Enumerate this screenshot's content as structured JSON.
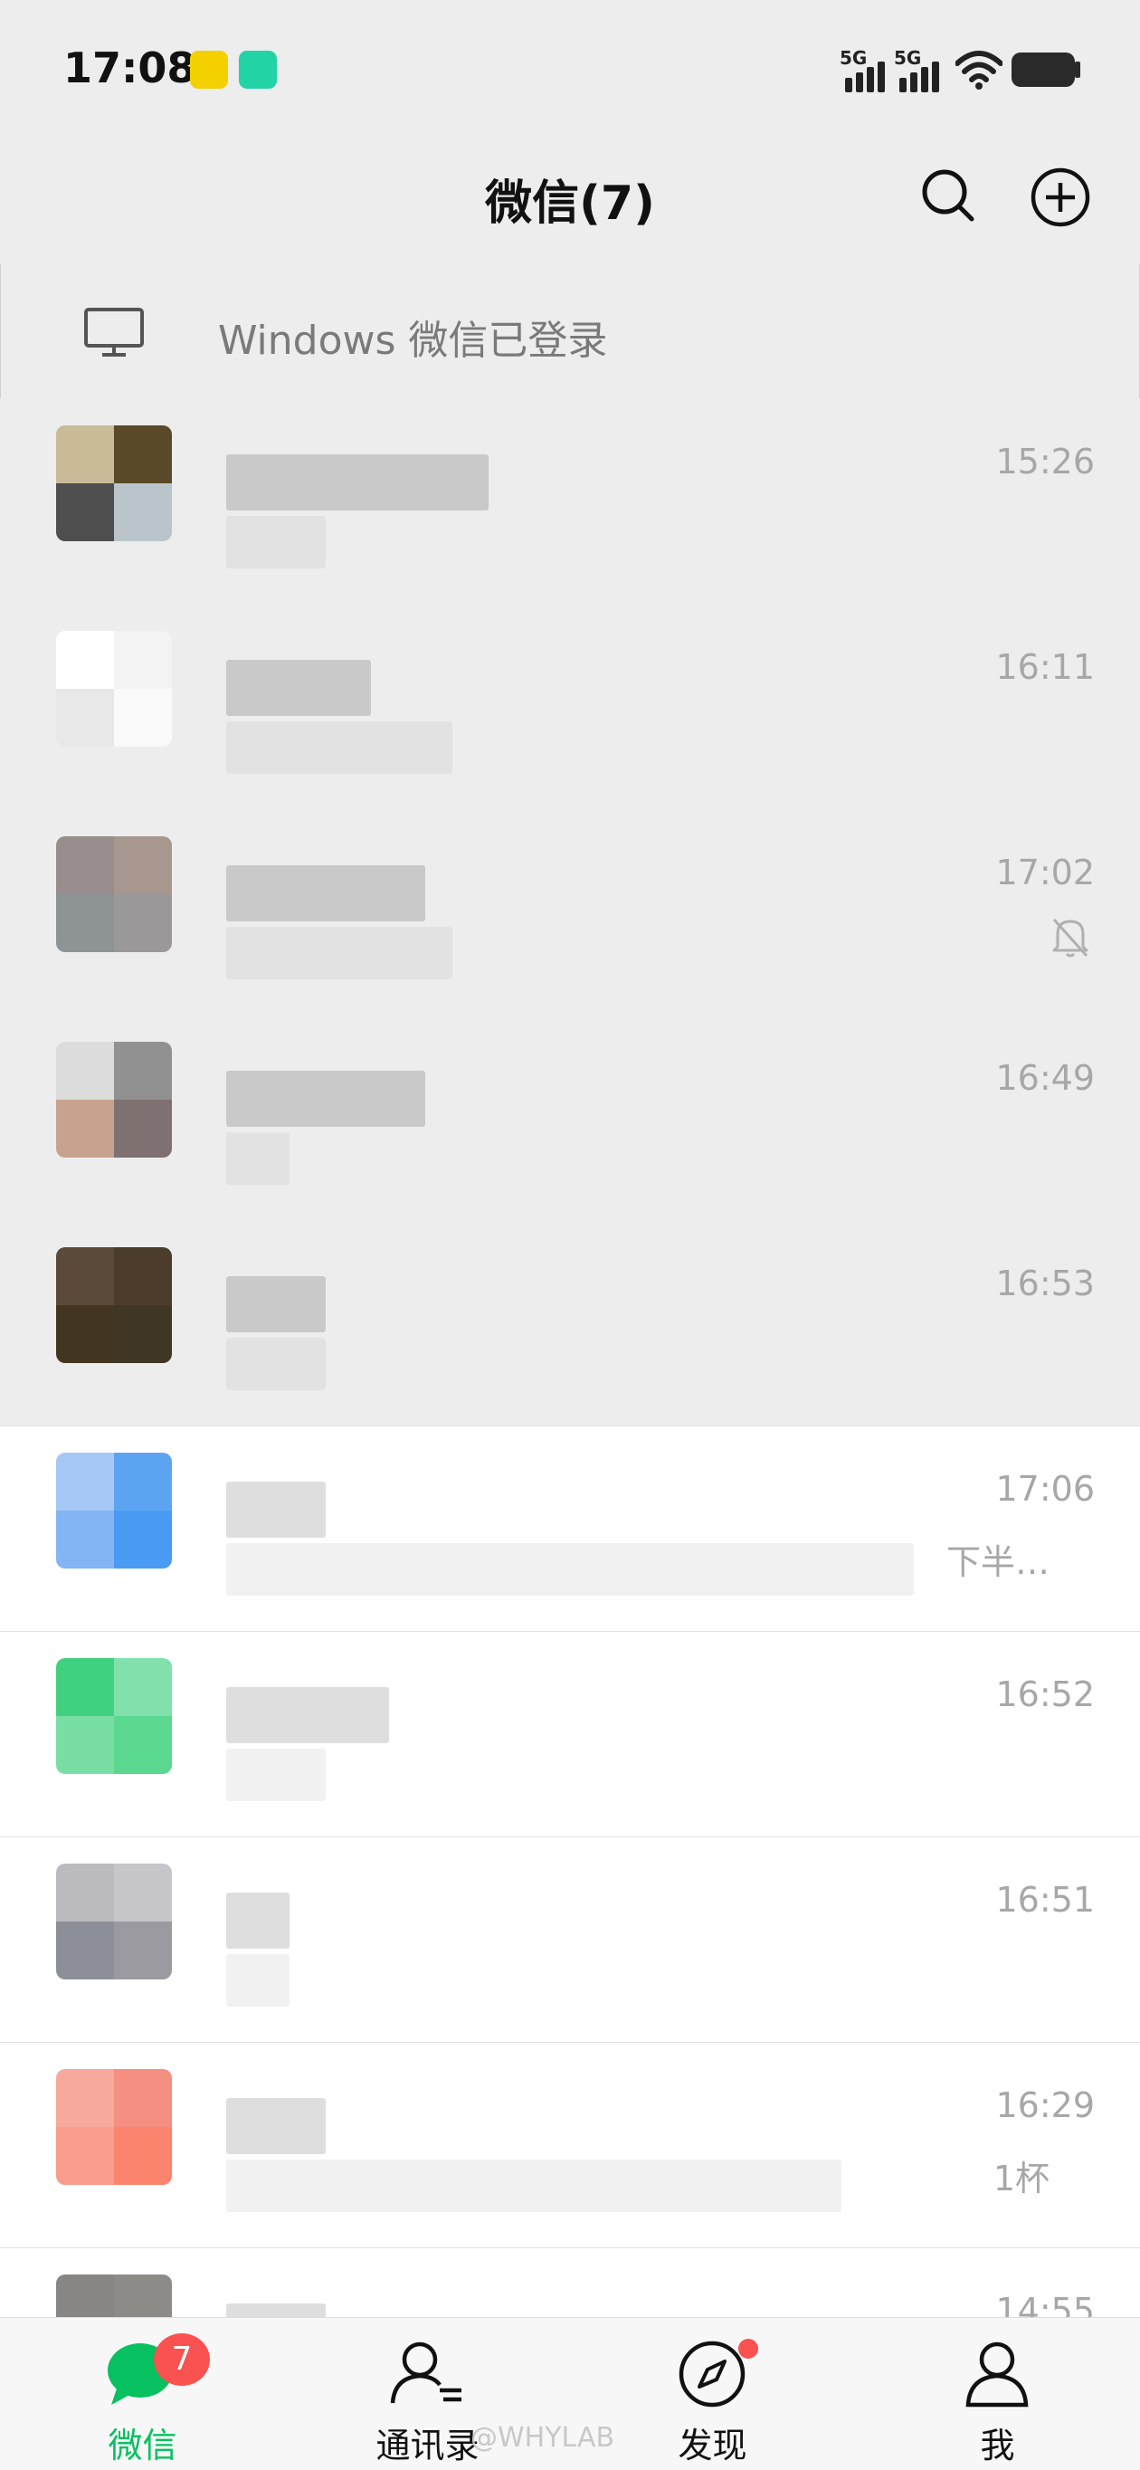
{
  "status_bar": {
    "time": "17:08",
    "network_1": "5G",
    "network_2": "5G"
  },
  "header": {
    "title": "微信(7)",
    "search_icon": "search-icon",
    "add_icon": "plus-circle-icon"
  },
  "login_banner": {
    "icon": "monitor-icon",
    "text": "Windows 微信已登录"
  },
  "chats": [
    {
      "time": "15:26",
      "pinned": true,
      "snippet": "",
      "muted": false
    },
    {
      "time": "16:11",
      "pinned": true,
      "snippet": "",
      "muted": false
    },
    {
      "time": "17:02",
      "pinned": true,
      "snippet": "",
      "muted": true
    },
    {
      "time": "16:49",
      "pinned": true,
      "snippet": "",
      "muted": false
    },
    {
      "time": "16:53",
      "pinned": true,
      "snippet": "",
      "muted": false
    },
    {
      "time": "17:06",
      "pinned": false,
      "snippet": "下半…",
      "muted": false
    },
    {
      "time": "16:52",
      "pinned": false,
      "snippet": "",
      "muted": false
    },
    {
      "time": "16:51",
      "pinned": false,
      "snippet": "",
      "muted": false
    },
    {
      "time": "16:29",
      "pinned": false,
      "snippet": "1杯",
      "muted": false
    },
    {
      "time": "14:55",
      "pinned": false,
      "snippet": "",
      "muted": false
    }
  ],
  "tabs": [
    {
      "label": "微信",
      "icon": "chat-bubble-icon",
      "active": true,
      "badge": "7"
    },
    {
      "label": "通讯录",
      "icon": "contacts-icon",
      "active": false
    },
    {
      "label": "发现",
      "icon": "compass-icon",
      "active": false,
      "dot": true
    },
    {
      "label": "我",
      "icon": "person-icon",
      "active": false
    }
  ],
  "watermark": "@WHYLAB",
  "colors": {
    "accent": "#07c160",
    "badge": "#fa5151",
    "header_bg": "#ededed",
    "pinned_bg": "#ededed"
  }
}
